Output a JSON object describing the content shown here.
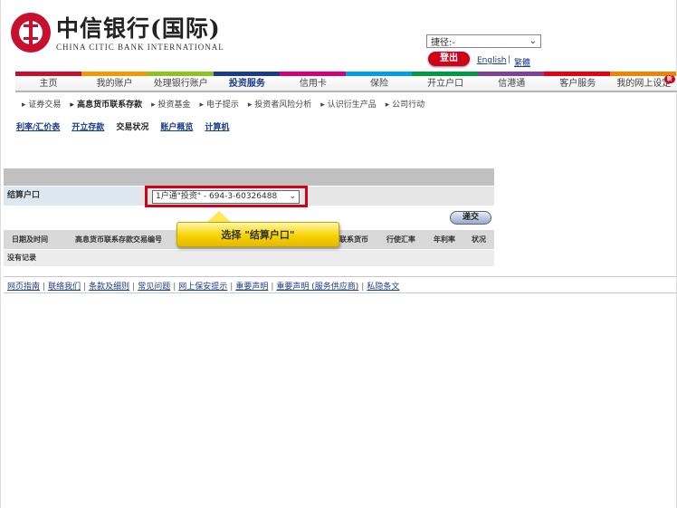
{
  "brand": {
    "name_cn": "中信银行(国际)",
    "name_en": "CHINA CITIC BANK INTERNATIONAL"
  },
  "header": {
    "shortcut_label": "捷径:-",
    "logout_label": "登出",
    "lang_english": "English",
    "lang_sep": "|",
    "lang_traditional": "繁體"
  },
  "nav": {
    "items": [
      "主页",
      "我的账户",
      "处理银行账户",
      "投资服务",
      "信用卡",
      "保险",
      "开立户口",
      "信港通",
      "客户服务",
      "我的网上设定"
    ],
    "active_index": 3,
    "new_badge": "新"
  },
  "colors": {
    "bar": [
      "#c8102e",
      "#f39800",
      "#8dc21f",
      "#1a3c8c",
      "#d4007a",
      "#00a0e9",
      "#009944",
      "#7f4199",
      "#e60012",
      "#f08300"
    ],
    "accent_red": "#d0021b",
    "link_blue": "#1a3c8c",
    "callout_yellow": "#f5d300"
  },
  "subnav": {
    "items": [
      "证券交易",
      "高息货币联系存款",
      "投资基金",
      "电子提示",
      "投资者风险分析",
      "认识衍生产品",
      "公司行动"
    ],
    "active_index": 1
  },
  "links": {
    "items": [
      "利率/汇价表",
      "开立存款",
      "交易状况",
      "账户概览",
      "计算机"
    ],
    "current_index": 2
  },
  "form": {
    "settlement_label": "结算户口",
    "account_value": "1户通\"投资\" - 694-3-60326488",
    "submit_label": "递交"
  },
  "table": {
    "headers": [
      "日期及时间",
      "高息货币联系存款交易编号",
      "联系货币",
      "行使汇率",
      "年利率",
      "状况"
    ],
    "empty_text": "没有记录"
  },
  "callout": {
    "prefix": "选择",
    "target": "\"结算户口\""
  },
  "footer": {
    "links": [
      "网页指南",
      "联络我们",
      "条款及细则",
      "常见问题",
      "网上保安提示",
      "重要声明",
      "重要声明 (服务供应商)",
      "私隐条文"
    ],
    "separator": "|"
  }
}
